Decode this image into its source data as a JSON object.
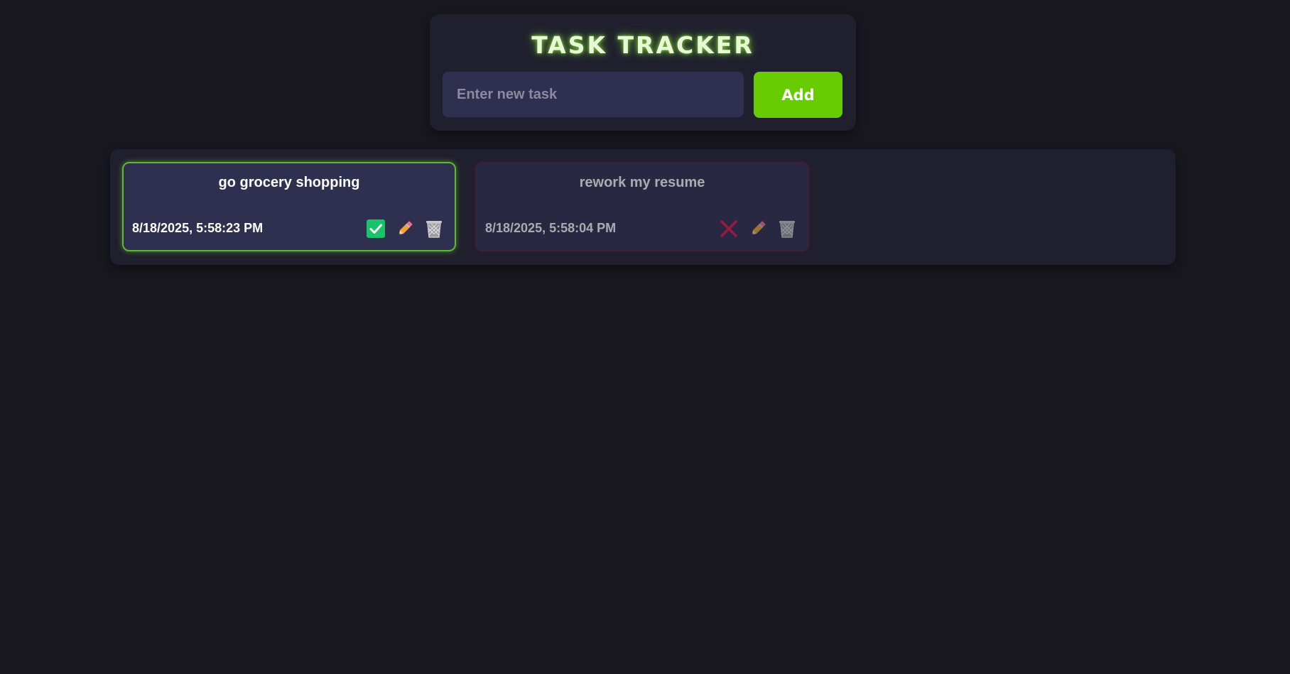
{
  "header": {
    "title": "TASK TRACKER",
    "input_placeholder": "Enter new task",
    "input_value": "",
    "add_label": "Add"
  },
  "tasks": [
    {
      "title": "go grocery shopping",
      "timestamp": "8/18/2025, 5:58:23 PM",
      "status": "completed",
      "status_icon": "checkbox-checked-icon",
      "accent": "#66cc00"
    },
    {
      "title": "rework my resume",
      "timestamp": "8/18/2025, 5:58:04 PM",
      "status": "pending",
      "status_icon": "cross-icon",
      "accent": "#b0183f"
    }
  ],
  "colors": {
    "background": "#191821",
    "panel": "#201f2e",
    "card": "#2f2f4f",
    "add_button": "#66cc00",
    "check": "#18c46a",
    "cross": "#c0183f",
    "pencil": "#f5a030",
    "trash": "#c8c8cc"
  }
}
